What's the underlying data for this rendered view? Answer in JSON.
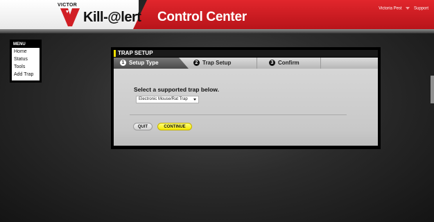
{
  "header": {
    "brand_small": "VICTOR",
    "brand": "Kill-@lert",
    "app_title": "Control Center",
    "user_name": "Victoria Pest",
    "support_link": "Support",
    "accent_red": "#d11f25"
  },
  "menu": {
    "heading": "MENU",
    "items": [
      "Home",
      "Status",
      "Tools",
      "Add Trap"
    ]
  },
  "panel": {
    "title": "TRAP SETUP",
    "steps": [
      {
        "num": "1",
        "label": "Setup Type",
        "active": true
      },
      {
        "num": "2",
        "label": "Trap Setup",
        "active": false
      },
      {
        "num": "3",
        "label": "Confirm",
        "active": false
      }
    ],
    "prompt": "Select a supported trap below.",
    "trap_select": {
      "value": "Electronic Mouse/Rat Trap"
    },
    "quit_label": "QUIT",
    "continue_label": "CONTINUE",
    "continue_color": "#f4e800"
  }
}
